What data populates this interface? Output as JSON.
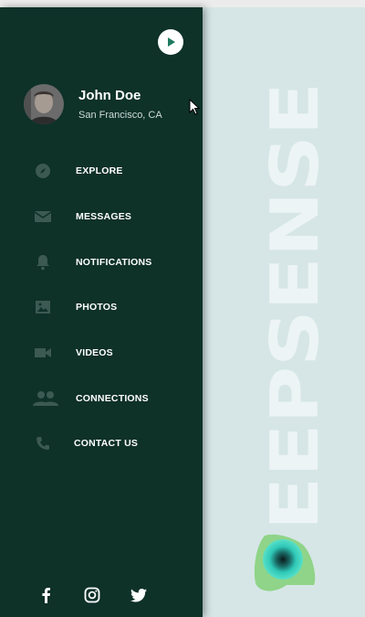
{
  "profile": {
    "name": "John Doe",
    "location": "San Francisco, CA"
  },
  "menu": {
    "items": [
      {
        "label": "EXPLORE",
        "icon": "compass-icon"
      },
      {
        "label": "MESSAGES",
        "icon": "envelope-icon"
      },
      {
        "label": "NOTIFICATIONS",
        "icon": "bell-icon"
      },
      {
        "label": "PHOTOS",
        "icon": "image-icon"
      },
      {
        "label": "VIDEOS",
        "icon": "video-camera-icon"
      },
      {
        "label": "CONNECTIONS",
        "icon": "people-icon"
      },
      {
        "label": "CONTACT US",
        "icon": "phone-icon"
      }
    ]
  },
  "social": [
    "facebook-icon",
    "instagram-icon",
    "twitter-icon"
  ],
  "brand": {
    "text": "EEPSENSE"
  },
  "colors": {
    "sidebar_bg": "#0e3128",
    "content_bg": "#d6e6e6",
    "icon_muted": "#3c5a52",
    "text": "#ffffff",
    "accent": "#1f7a60"
  }
}
